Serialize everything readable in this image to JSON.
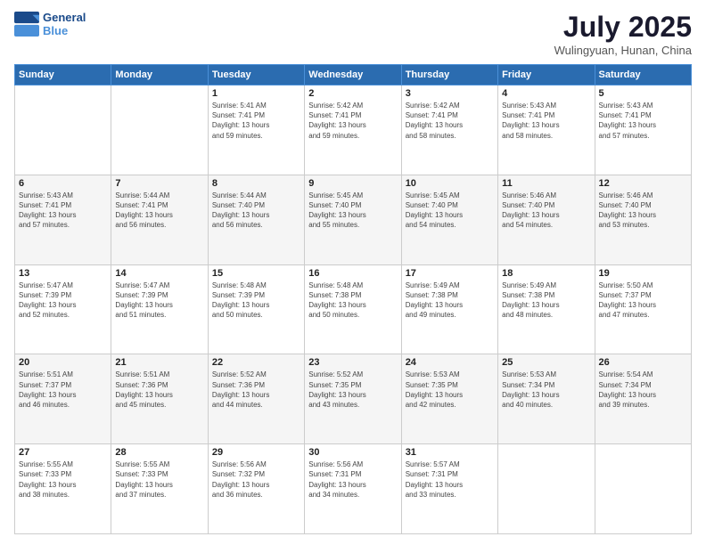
{
  "header": {
    "logo_line1": "General",
    "logo_line2": "Blue",
    "month": "July 2025",
    "location": "Wulingyuan, Hunan, China"
  },
  "weekdays": [
    "Sunday",
    "Monday",
    "Tuesday",
    "Wednesday",
    "Thursday",
    "Friday",
    "Saturday"
  ],
  "weeks": [
    [
      {
        "day": "",
        "info": ""
      },
      {
        "day": "",
        "info": ""
      },
      {
        "day": "1",
        "info": "Sunrise: 5:41 AM\nSunset: 7:41 PM\nDaylight: 13 hours\nand 59 minutes."
      },
      {
        "day": "2",
        "info": "Sunrise: 5:42 AM\nSunset: 7:41 PM\nDaylight: 13 hours\nand 59 minutes."
      },
      {
        "day": "3",
        "info": "Sunrise: 5:42 AM\nSunset: 7:41 PM\nDaylight: 13 hours\nand 58 minutes."
      },
      {
        "day": "4",
        "info": "Sunrise: 5:43 AM\nSunset: 7:41 PM\nDaylight: 13 hours\nand 58 minutes."
      },
      {
        "day": "5",
        "info": "Sunrise: 5:43 AM\nSunset: 7:41 PM\nDaylight: 13 hours\nand 57 minutes."
      }
    ],
    [
      {
        "day": "6",
        "info": "Sunrise: 5:43 AM\nSunset: 7:41 PM\nDaylight: 13 hours\nand 57 minutes."
      },
      {
        "day": "7",
        "info": "Sunrise: 5:44 AM\nSunset: 7:41 PM\nDaylight: 13 hours\nand 56 minutes."
      },
      {
        "day": "8",
        "info": "Sunrise: 5:44 AM\nSunset: 7:40 PM\nDaylight: 13 hours\nand 56 minutes."
      },
      {
        "day": "9",
        "info": "Sunrise: 5:45 AM\nSunset: 7:40 PM\nDaylight: 13 hours\nand 55 minutes."
      },
      {
        "day": "10",
        "info": "Sunrise: 5:45 AM\nSunset: 7:40 PM\nDaylight: 13 hours\nand 54 minutes."
      },
      {
        "day": "11",
        "info": "Sunrise: 5:46 AM\nSunset: 7:40 PM\nDaylight: 13 hours\nand 54 minutes."
      },
      {
        "day": "12",
        "info": "Sunrise: 5:46 AM\nSunset: 7:40 PM\nDaylight: 13 hours\nand 53 minutes."
      }
    ],
    [
      {
        "day": "13",
        "info": "Sunrise: 5:47 AM\nSunset: 7:39 PM\nDaylight: 13 hours\nand 52 minutes."
      },
      {
        "day": "14",
        "info": "Sunrise: 5:47 AM\nSunset: 7:39 PM\nDaylight: 13 hours\nand 51 minutes."
      },
      {
        "day": "15",
        "info": "Sunrise: 5:48 AM\nSunset: 7:39 PM\nDaylight: 13 hours\nand 50 minutes."
      },
      {
        "day": "16",
        "info": "Sunrise: 5:48 AM\nSunset: 7:38 PM\nDaylight: 13 hours\nand 50 minutes."
      },
      {
        "day": "17",
        "info": "Sunrise: 5:49 AM\nSunset: 7:38 PM\nDaylight: 13 hours\nand 49 minutes."
      },
      {
        "day": "18",
        "info": "Sunrise: 5:49 AM\nSunset: 7:38 PM\nDaylight: 13 hours\nand 48 minutes."
      },
      {
        "day": "19",
        "info": "Sunrise: 5:50 AM\nSunset: 7:37 PM\nDaylight: 13 hours\nand 47 minutes."
      }
    ],
    [
      {
        "day": "20",
        "info": "Sunrise: 5:51 AM\nSunset: 7:37 PM\nDaylight: 13 hours\nand 46 minutes."
      },
      {
        "day": "21",
        "info": "Sunrise: 5:51 AM\nSunset: 7:36 PM\nDaylight: 13 hours\nand 45 minutes."
      },
      {
        "day": "22",
        "info": "Sunrise: 5:52 AM\nSunset: 7:36 PM\nDaylight: 13 hours\nand 44 minutes."
      },
      {
        "day": "23",
        "info": "Sunrise: 5:52 AM\nSunset: 7:35 PM\nDaylight: 13 hours\nand 43 minutes."
      },
      {
        "day": "24",
        "info": "Sunrise: 5:53 AM\nSunset: 7:35 PM\nDaylight: 13 hours\nand 42 minutes."
      },
      {
        "day": "25",
        "info": "Sunrise: 5:53 AM\nSunset: 7:34 PM\nDaylight: 13 hours\nand 40 minutes."
      },
      {
        "day": "26",
        "info": "Sunrise: 5:54 AM\nSunset: 7:34 PM\nDaylight: 13 hours\nand 39 minutes."
      }
    ],
    [
      {
        "day": "27",
        "info": "Sunrise: 5:55 AM\nSunset: 7:33 PM\nDaylight: 13 hours\nand 38 minutes."
      },
      {
        "day": "28",
        "info": "Sunrise: 5:55 AM\nSunset: 7:33 PM\nDaylight: 13 hours\nand 37 minutes."
      },
      {
        "day": "29",
        "info": "Sunrise: 5:56 AM\nSunset: 7:32 PM\nDaylight: 13 hours\nand 36 minutes."
      },
      {
        "day": "30",
        "info": "Sunrise: 5:56 AM\nSunset: 7:31 PM\nDaylight: 13 hours\nand 34 minutes."
      },
      {
        "day": "31",
        "info": "Sunrise: 5:57 AM\nSunset: 7:31 PM\nDaylight: 13 hours\nand 33 minutes."
      },
      {
        "day": "",
        "info": ""
      },
      {
        "day": "",
        "info": ""
      }
    ]
  ]
}
